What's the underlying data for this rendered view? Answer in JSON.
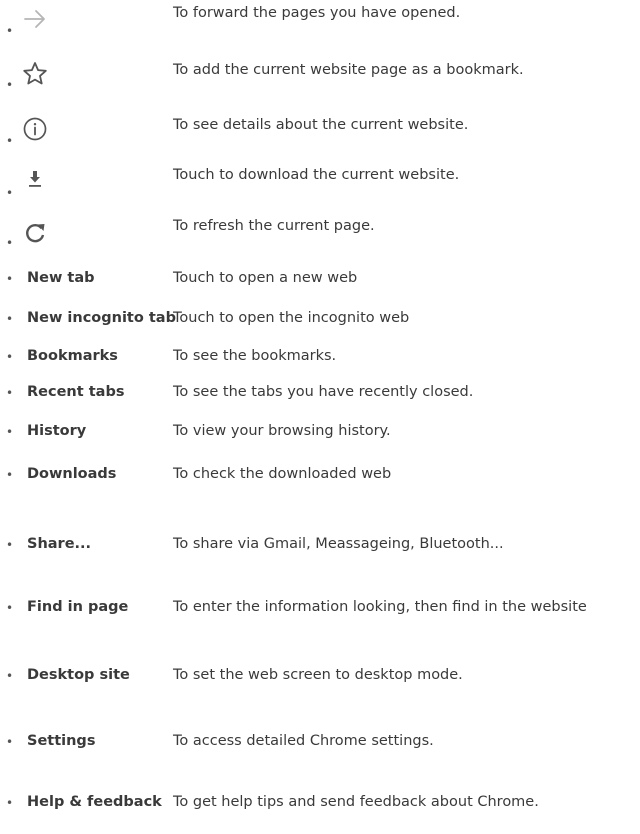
{
  "icon_rows": [
    {
      "icon": "arrow-right-icon",
      "description": "To forward the pages you have opened."
    },
    {
      "icon": "star-outline-icon",
      "description": "To add the current website page as a bookmark."
    },
    {
      "icon": "info-circle-icon",
      "description": "To see details about the current website."
    },
    {
      "icon": "download-icon",
      "description": "Touch to download the current website."
    },
    {
      "icon": "refresh-icon",
      "description": "To refresh the current page."
    }
  ],
  "menu_rows": [
    {
      "label": "New tab",
      "description": "Touch to open a new web"
    },
    {
      "label": "New incognito tab",
      "description": "Touch to open the incognito web"
    },
    {
      "label": "Bookmarks",
      "description": "To see the bookmarks."
    },
    {
      "label": "Recent tabs",
      "description": "To see the tabs you have recently closed."
    },
    {
      "label": "History",
      "description": "To view your browsing history."
    },
    {
      "label": "Downloads",
      "description": "To check the downloaded web"
    },
    {
      "label": "Share...",
      "description": "To share via Gmail, Meassageing, Bluetooth..."
    },
    {
      "label": "Find in page",
      "description": "To enter the information looking, then find in the website"
    },
    {
      "label": "Desktop site",
      "description": "To set the web screen to desktop mode."
    },
    {
      "label": "Settings",
      "description": "To access detailed Chrome settings."
    },
    {
      "label": "Help & feedback",
      "description": "To get help tips and send feedback about Chrome."
    }
  ],
  "colors": {
    "text": "#3a3a3a",
    "icon": "#555555",
    "icon_light": "#b5b5b5"
  }
}
